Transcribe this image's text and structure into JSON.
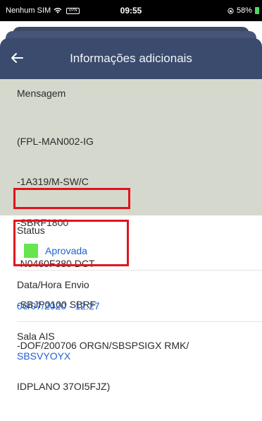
{
  "status_bar": {
    "carrier": "Nenhum SIM",
    "vpn": "VPN",
    "time": "09:55",
    "battery": "58%"
  },
  "header": {
    "title": "Informações adicionais",
    "back_icon": "arrow-left-icon"
  },
  "message": {
    "label": "Mensagem",
    "lines": [
      "(FPL-MAN002-IG",
      "-1A319/M-SW/C",
      "-SBRF1800",
      "-N0460F380 DCT",
      "-SBJP0100 SBRF",
      "-DOF/200706 ORGN/SBSPSIGX RMK/",
      "IDPLANO 37OI5FJZ)"
    ]
  },
  "status": {
    "label": "Status",
    "value": "Aprovada",
    "color": "#66e54f"
  },
  "sent": {
    "label": "Data/Hora Envio",
    "value": "06/07/2020 - 12:27"
  },
  "room": {
    "label": "Sala AIS",
    "value": "SBSVYOYX"
  },
  "colors": {
    "header": "#3a4b6e",
    "message_bg": "#d5d8cc",
    "link": "#1f5fd6",
    "highlight": "#e0141e"
  }
}
